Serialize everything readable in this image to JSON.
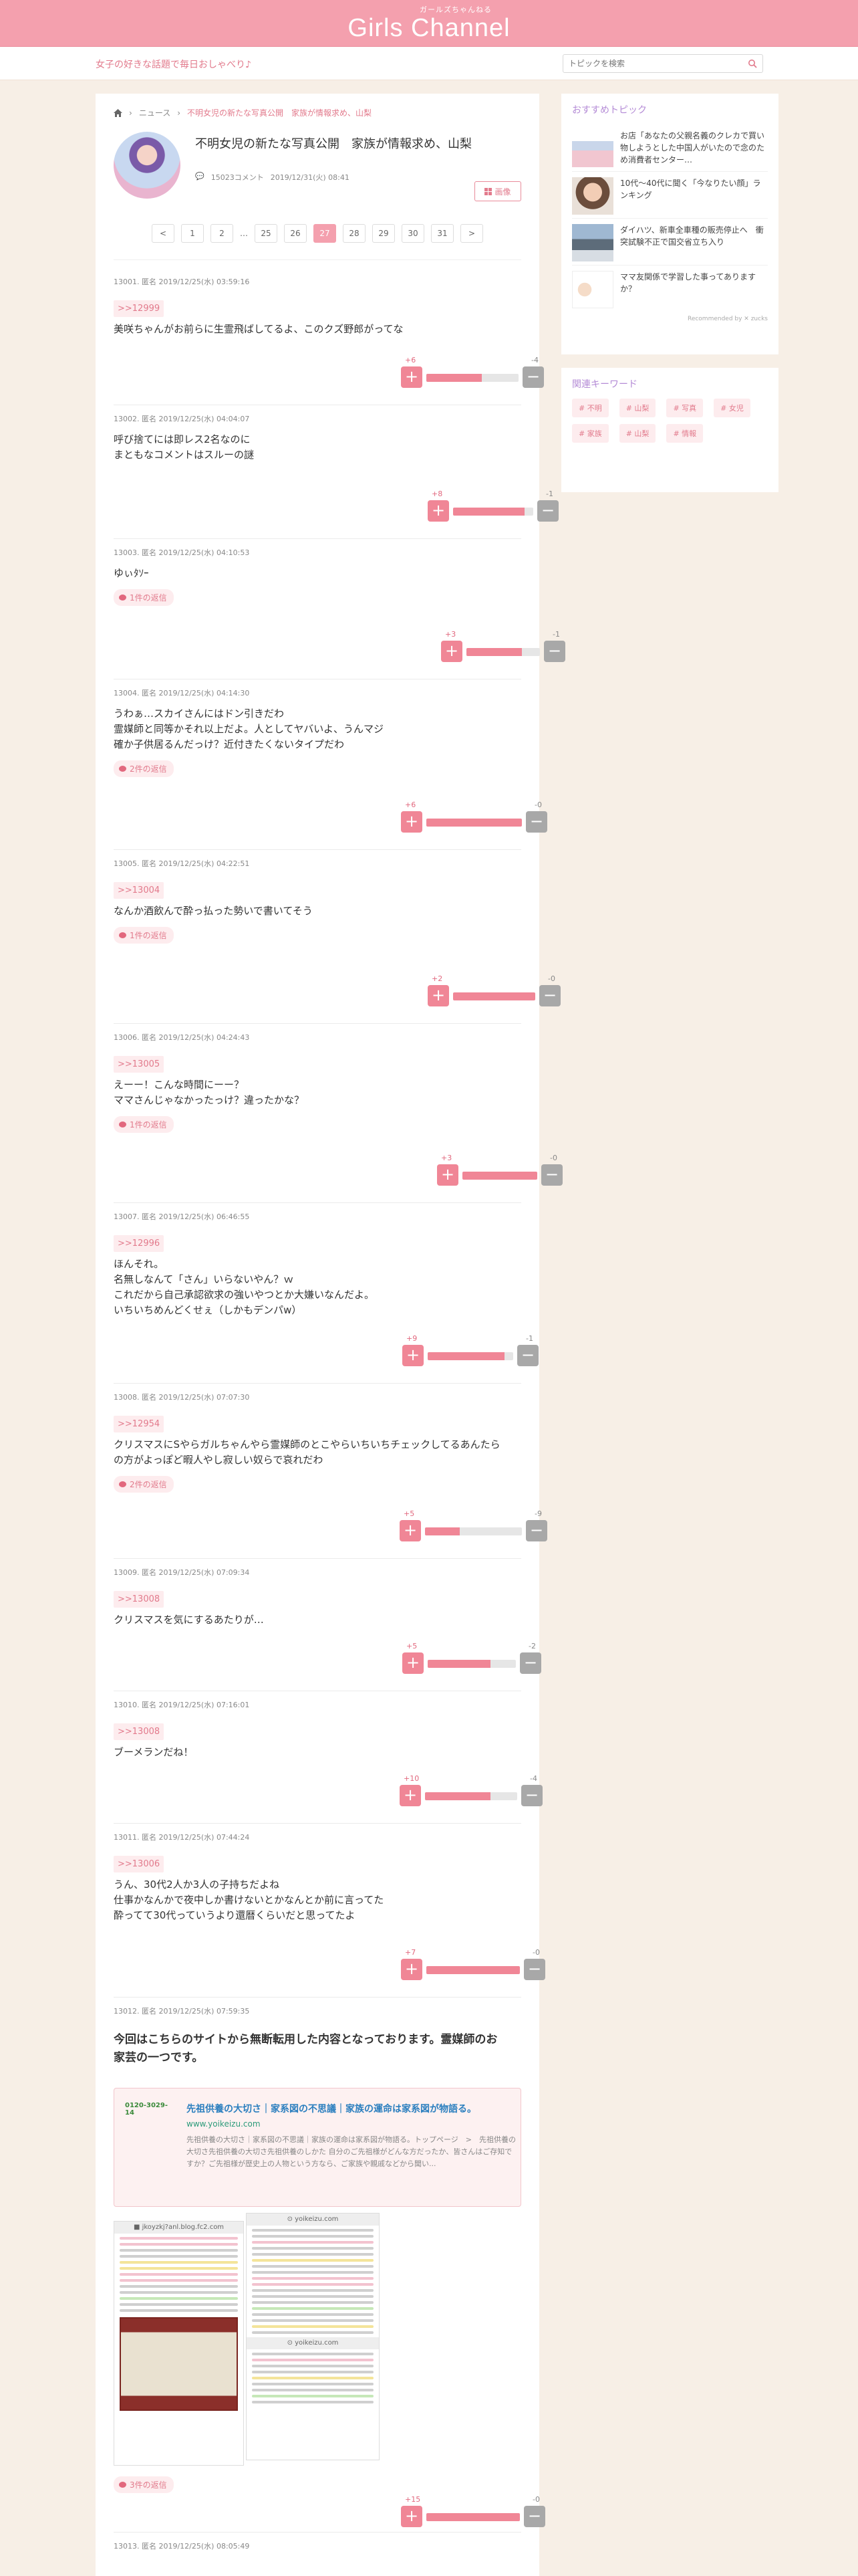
{
  "site": {
    "kana": "ガールズちゃんねる",
    "name": "Girls Channel",
    "tagline": "女子の好きな話題で毎日おしゃべり♪",
    "search_placeholder": "トピックを検索"
  },
  "breadcrumb": {
    "home": "ホーム",
    "category": "ニュース",
    "current": "不明女児の新たな写真公開　家族が情報求め、山梨"
  },
  "topic": {
    "title": "不明女児の新たな写真公開　家族が情報求め、山梨",
    "comments": "15023コメント",
    "date": "2019/12/31(火) 08:41",
    "fav_label": "画像"
  },
  "pager": {
    "prev": "<",
    "pages": [
      "1",
      "2",
      "…",
      "25",
      "26",
      "27",
      "28",
      "29",
      "30",
      "31"
    ],
    "current": "27",
    "next": ">"
  },
  "comments": [
    {
      "head": "13001. 匿名 2019/12/25(水) 03:59:16",
      "ref": ">>12999",
      "body": [
        "美咲ちゃんがお前らに生霊飛ばしてるよ、このクズ野郎がってな"
      ],
      "reply": "",
      "plus": "+6",
      "minus": "-4",
      "ratio": 0.6
    },
    {
      "head": "13002. 匿名 2019/12/25(水) 04:04:07",
      "ref": "",
      "body": [
        "呼び捨てには即レス2名なのに",
        "まともなコメントはスルーの謎"
      ],
      "reply": "",
      "plus": "+8",
      "minus": "-1",
      "ratio": 0.89
    },
    {
      "head": "13003. 匿名 2019/12/25(水) 04:10:53",
      "ref": "",
      "body": [
        "ゆぃﾀｿｰ"
      ],
      "reply": "1件の返信",
      "plus": "+3",
      "minus": "-1",
      "ratio": 0.75
    },
    {
      "head": "13004. 匿名 2019/12/25(水) 04:14:30",
      "ref": "",
      "body": [
        "うわぁ…スカイさんにはドン引きだわ",
        "霊媒師と同等かそれ以上だよ。人としてヤバいよ、うんマジ",
        "確か子供居るんだっけ？近付きたくないタイプだわ"
      ],
      "reply": "2件の返信",
      "plus": "+6",
      "minus": "-0",
      "ratio": 1.0
    },
    {
      "head": "13005. 匿名 2019/12/25(水) 04:22:51",
      "ref": ">>13004",
      "body": [
        "なんか酒飲んで酔っ払った勢いで書いてそう"
      ],
      "reply": "1件の返信",
      "plus": "+2",
      "minus": "-0",
      "ratio": 1.0
    },
    {
      "head": "13006. 匿名 2019/12/25(水) 04:24:43",
      "ref": ">>13005",
      "body": [
        "えーー！こんな時間にーー？",
        "ママさんじゃなかったっけ？違ったかな？"
      ],
      "reply": "1件の返信",
      "plus": "+3",
      "minus": "-0",
      "ratio": 1.0
    },
    {
      "head": "13007. 匿名 2019/12/25(水) 06:46:55",
      "ref": ">>12996",
      "body": [
        "ほんそれ。",
        "名無しなんて「さん」いらないやん？ｗ",
        "これだから自己承認欲求の強いやつとか大嫌いなんだよ。",
        "いちいちめんどくせぇ（しかもデンパw）"
      ],
      "reply": "",
      "plus": "+9",
      "minus": "-1",
      "ratio": 0.9
    },
    {
      "head": "13008. 匿名 2019/12/25(水) 07:07:30",
      "ref": ">>12954",
      "body": [
        "クリスマスにSやらガルちゃんやら霊媒師のとこやらいちいちチェックしてるあんたら",
        "の方がよっぽど暇人やし寂しい奴らで哀れだわ"
      ],
      "reply": "2件の返信",
      "plus": "+5",
      "minus": "-9",
      "ratio": 0.36
    },
    {
      "head": "13009. 匿名 2019/12/25(水) 07:09:34",
      "ref": ">>13008",
      "body": [
        "クリスマスを気にするあたりが…"
      ],
      "reply": "",
      "plus": "+5",
      "minus": "-2",
      "ratio": 0.71
    },
    {
      "head": "13010. 匿名 2019/12/25(水) 07:16:01",
      "ref": ">>13008",
      "body": [
        "ブーメランだね！"
      ],
      "reply": "",
      "plus": "+10",
      "minus": "-4",
      "ratio": 0.71
    },
    {
      "head": "13011. 匿名 2019/12/25(水) 07:44:24",
      "ref": ">>13006",
      "body": [
        "うん、30代2人か3人の子持ちだよね",
        "仕事かなんかで夜中しか書けないとかなんとか前に言ってた",
        "酔ってて30代っていうより還暦くらいだと思ってたよ"
      ],
      "reply": "",
      "plus": "+7",
      "minus": "-0",
      "ratio": 1.0
    }
  ],
  "last_comment": {
    "head": "13012. 匿名 2019/12/25(水) 07:59:35",
    "body": [
      "今回はこちらのサイトから無断転用した内容となっております。霊媒師のお",
      "家芸の一つです。"
    ],
    "quote": {
      "img_text": "0120-3029-14",
      "title": "先祖供養の大切さ｜家系図の不思議｜家族の運命は家系図が物語る。",
      "url": "www.yoikeizu.com",
      "text": "先祖供養の大切さ｜家系図の不思議｜家族の運命は家系図が物語る。トップページ　>　先祖供養の大切さ先祖供養の大切さ先祖供養のしかた 自分のご先祖様がどんな方だったか、皆さんはご存知ですか？ご先祖様が歴史上の人物という方なら、ご家族や親戚などから聞い..."
    },
    "shot_left_bar": "■ jkoyzkj?anl.blog.fc2.com",
    "shot_right_bar": "⊙ yoikeizu.com",
    "shot_right_mid": "⊙ yoikeizu.com",
    "reply": "3件の返信",
    "plus": "+15",
    "minus": "-0",
    "ratio": 1.0
  },
  "next_head": "13013. 匿名 2019/12/25(水) 08:05:49",
  "sidebar": {
    "rec_title": "おすすめトピック",
    "recs": [
      "お店「あなたの父親名義のクレカで買い物しようとした中国人がいたので念のため消費者センター…",
      "10代〜40代に聞く「今なりたい顔」ランキング",
      "ダイハツ、新車全車種の販売停止へ　衝突試験不正で国交省立ち入り",
      "ママ友関係で学習した事ってありますか？"
    ],
    "rec_footer": "Recommended by ✕ zucks",
    "kw_title": "関連キーワード",
    "keywords": [
      "# 不明",
      "# 山梨",
      "# 写真",
      "# 女児",
      "# 家族",
      "# 山梨",
      "# 情報"
    ]
  },
  "colors": {
    "brand_pink": "#f4a0ae",
    "accent_pink": "#e27a8c",
    "bg": "#f7efe6"
  }
}
